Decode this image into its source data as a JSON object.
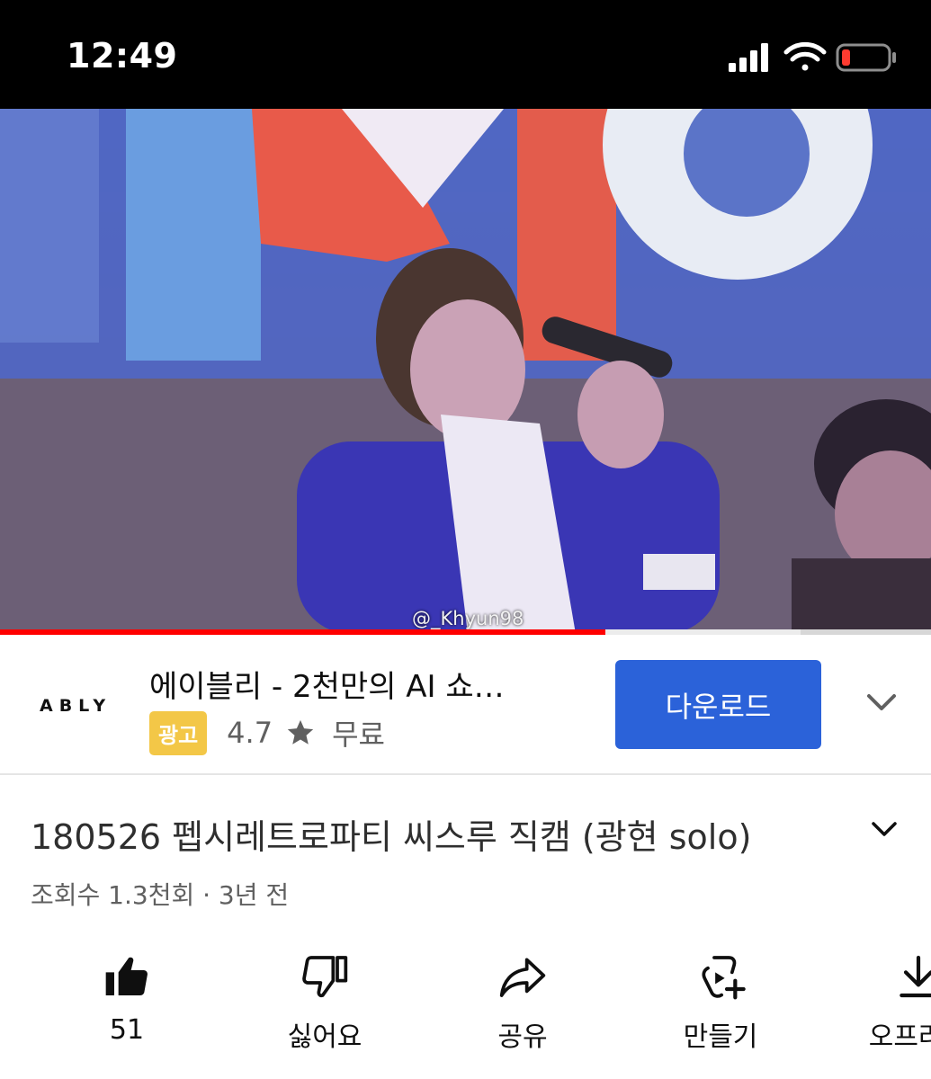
{
  "status_bar": {
    "time": "12:49",
    "icons": [
      "cellular-signal-icon",
      "wifi-icon",
      "battery-low-icon"
    ],
    "battery_color": "#ff3b30"
  },
  "video": {
    "watermark": "@_Khyun98",
    "progress_fraction": 0.65,
    "buffered_fraction": 0.86,
    "progress_color": "#ff0000"
  },
  "ad": {
    "logo": "ABLY",
    "title": "에이블리 - 2천만의 AI 쇼…",
    "badge": "광고",
    "badge_color": "#f3c747",
    "rating": "4.7",
    "price": "무료",
    "cta": "다운로드",
    "cta_color": "#2b62d9"
  },
  "video_info": {
    "title": "180526 펩시레트로파티 씨스루 직캠 (광현 solo)",
    "meta": "조회수 1.3천회 · 3년 전"
  },
  "actions": [
    {
      "icon": "thumbs-up-icon",
      "label": "51"
    },
    {
      "icon": "thumbs-down-icon",
      "label": "싫어요"
    },
    {
      "icon": "share-icon",
      "label": "공유"
    },
    {
      "icon": "create-icon",
      "label": "만들기"
    },
    {
      "icon": "download-icon",
      "label": "오프라인"
    }
  ]
}
